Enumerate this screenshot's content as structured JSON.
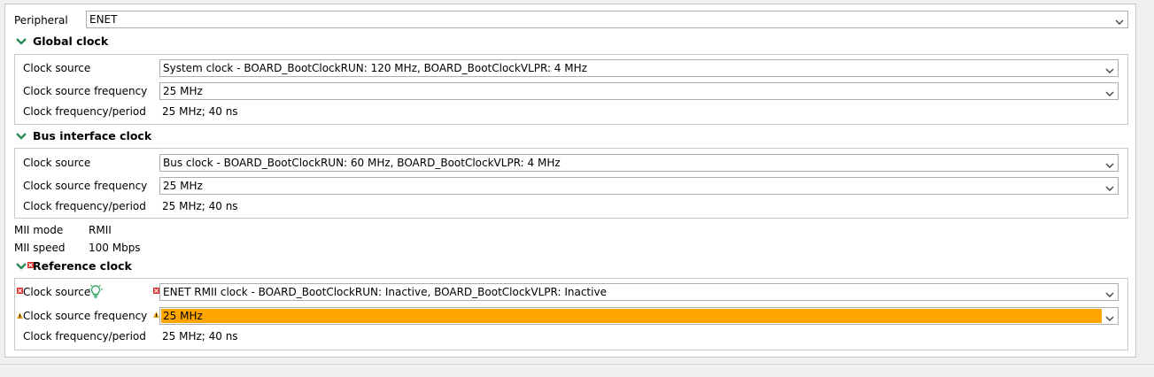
{
  "peripheral": {
    "label": "Peripheral",
    "value": "ENET"
  },
  "global_clock": {
    "title": "Global clock",
    "clock_source_label": "Clock source",
    "clock_source_value": "System clock - BOARD_BootClockRUN: 120 MHz, BOARD_BootClockVLPR: 4 MHz",
    "freq_label": "Clock source frequency",
    "freq_value": "25 MHz",
    "period_label": "Clock frequency/period",
    "period_value": "25 MHz; 40 ns"
  },
  "bus_clock": {
    "title": "Bus interface clock",
    "clock_source_label": "Clock source",
    "clock_source_value": "Bus clock - BOARD_BootClockRUN: 60 MHz, BOARD_BootClockVLPR: 4 MHz",
    "freq_label": "Clock source frequency",
    "freq_value": "25 MHz",
    "period_label": "Clock frequency/period",
    "period_value": "25 MHz; 40 ns"
  },
  "mii": {
    "mode_label": "MII mode",
    "mode_value": "RMII",
    "speed_label": "MII speed",
    "speed_value": "100 Mbps"
  },
  "reference_clock": {
    "title": "Reference clock",
    "clock_source_label": "Clock source",
    "clock_source_value": "ENET RMII clock - BOARD_BootClockRUN: Inactive, BOARD_BootClockVLPR: Inactive",
    "freq_label": "Clock source frequency",
    "freq_value": "25 MHz",
    "period_label": "Clock frequency/period",
    "period_value": "25 MHz; 40 ns"
  },
  "colors": {
    "chevron": "#2e8b57",
    "error": "#d9302a",
    "warning": "#e8a317",
    "warning_fill": "#ffa500",
    "hint_bulb": "#3aa86b"
  },
  "icons": {
    "expand": "chevron-down-icon",
    "error": "error-marker-icon",
    "warning": "warning-marker-icon",
    "hint": "lightbulb-icon",
    "dropdown": "dropdown-arrow-icon"
  }
}
